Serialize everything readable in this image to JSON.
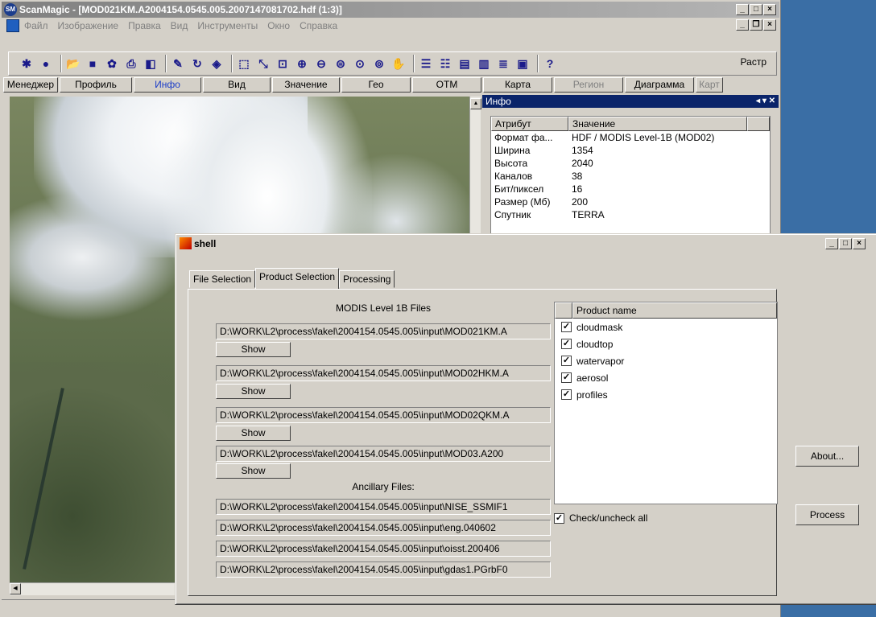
{
  "main": {
    "title": "ScanMagic - [MOD021KM.A2004154.0545.005.2007147081702.hdf (1:3)]",
    "app_icon": "SM",
    "menu": [
      "Файл",
      "Изображение",
      "Правка",
      "Вид",
      "Инструменты",
      "Окно",
      "Справка"
    ],
    "rastr_label": "Растр",
    "tabs": [
      {
        "label": "Менеджер",
        "width": 68,
        "state": "normal"
      },
      {
        "label": "Профиль",
        "width": 90,
        "state": "normal"
      },
      {
        "label": "Инфо",
        "width": 84,
        "state": "active"
      },
      {
        "label": "Вид",
        "width": 84,
        "state": "normal"
      },
      {
        "label": "Значение",
        "width": 84,
        "state": "normal"
      },
      {
        "label": "Гео",
        "width": 86,
        "state": "normal"
      },
      {
        "label": "ОТМ",
        "width": 86,
        "state": "normal"
      },
      {
        "label": "Карта",
        "width": 86,
        "state": "normal"
      },
      {
        "label": "Регион",
        "width": 86,
        "state": "disabled"
      },
      {
        "label": "Диаграмма",
        "width": 86,
        "state": "normal"
      },
      {
        "label": "Карт",
        "width": 34,
        "state": "disabled"
      }
    ],
    "info": {
      "title": "Инфо",
      "controls": "◂ ▾ ✕",
      "header": {
        "attr": "Атрибут",
        "value": "Значение"
      },
      "rows": [
        {
          "attr": "Формат фа...",
          "value": "HDF / MODIS Level-1B (MOD02)"
        },
        {
          "attr": "Ширина",
          "value": "1354"
        },
        {
          "attr": "Высота",
          "value": "2040"
        },
        {
          "attr": "Каналов",
          "value": "38"
        },
        {
          "attr": "Бит/пиксел",
          "value": "16"
        },
        {
          "attr": "Размер (Мб)",
          "value": "200"
        },
        {
          "attr": "Спутник",
          "value": "TERRA"
        }
      ]
    }
  },
  "shell": {
    "title": "shell",
    "tabs": [
      "File Selection",
      "Product Selection",
      "Processing"
    ],
    "active_tab": 1,
    "modis_label": "MODIS Level 1B Files",
    "modis_files": [
      "D:\\WORK\\L2\\process\\fakel\\2004154.0545.005\\input\\MOD021KM.A",
      "D:\\WORK\\L2\\process\\fakel\\2004154.0545.005\\input\\MOD02HKM.A",
      "D:\\WORK\\L2\\process\\fakel\\2004154.0545.005\\input\\MOD02QKM.A",
      "D:\\WORK\\L2\\process\\fakel\\2004154.0545.005\\input\\MOD03.A200"
    ],
    "show_label": "Show",
    "ancillary_label": "Ancillary Files:",
    "ancillary_files": [
      "D:\\WORK\\L2\\process\\fakel\\2004154.0545.005\\input\\NISE_SSMIF1",
      "D:\\WORK\\L2\\process\\fakel\\2004154.0545.005\\input\\eng.040602",
      "D:\\WORK\\L2\\process\\fakel\\2004154.0545.005\\input\\oisst.200406",
      "D:\\WORK\\L2\\process\\fakel\\2004154.0545.005\\input\\gdas1.PGrbF0"
    ],
    "product_header": "Product name",
    "products": [
      {
        "name": "cloudmask",
        "checked": true
      },
      {
        "name": "cloudtop",
        "checked": true
      },
      {
        "name": "watervapor",
        "checked": true
      },
      {
        "name": "aerosol",
        "checked": true
      },
      {
        "name": "profiles",
        "checked": true
      }
    ],
    "check_all_label": "Check/uncheck all",
    "check_all": true,
    "about_label": "About...",
    "process_label": "Process"
  },
  "toolbar_icons": [
    "new-icon",
    "circle-icon",
    "open-icon",
    "save-icon",
    "settings-icon",
    "print-icon",
    "preview-icon",
    "brush-icon",
    "rotate-icon",
    "layers-icon",
    "select-icon",
    "zoom-select-icon",
    "zoom-rect-icon",
    "zoom-in-icon",
    "zoom-out-icon",
    "zoom-fit-icon",
    "zoom-actual-icon",
    "zoom-window-icon",
    "pan-hand-icon",
    "arrange-1-icon",
    "arrange-2-icon",
    "arrange-3-icon",
    "arrange-4-icon",
    "arrange-5-icon",
    "arrange-6-icon",
    "help-icon"
  ]
}
